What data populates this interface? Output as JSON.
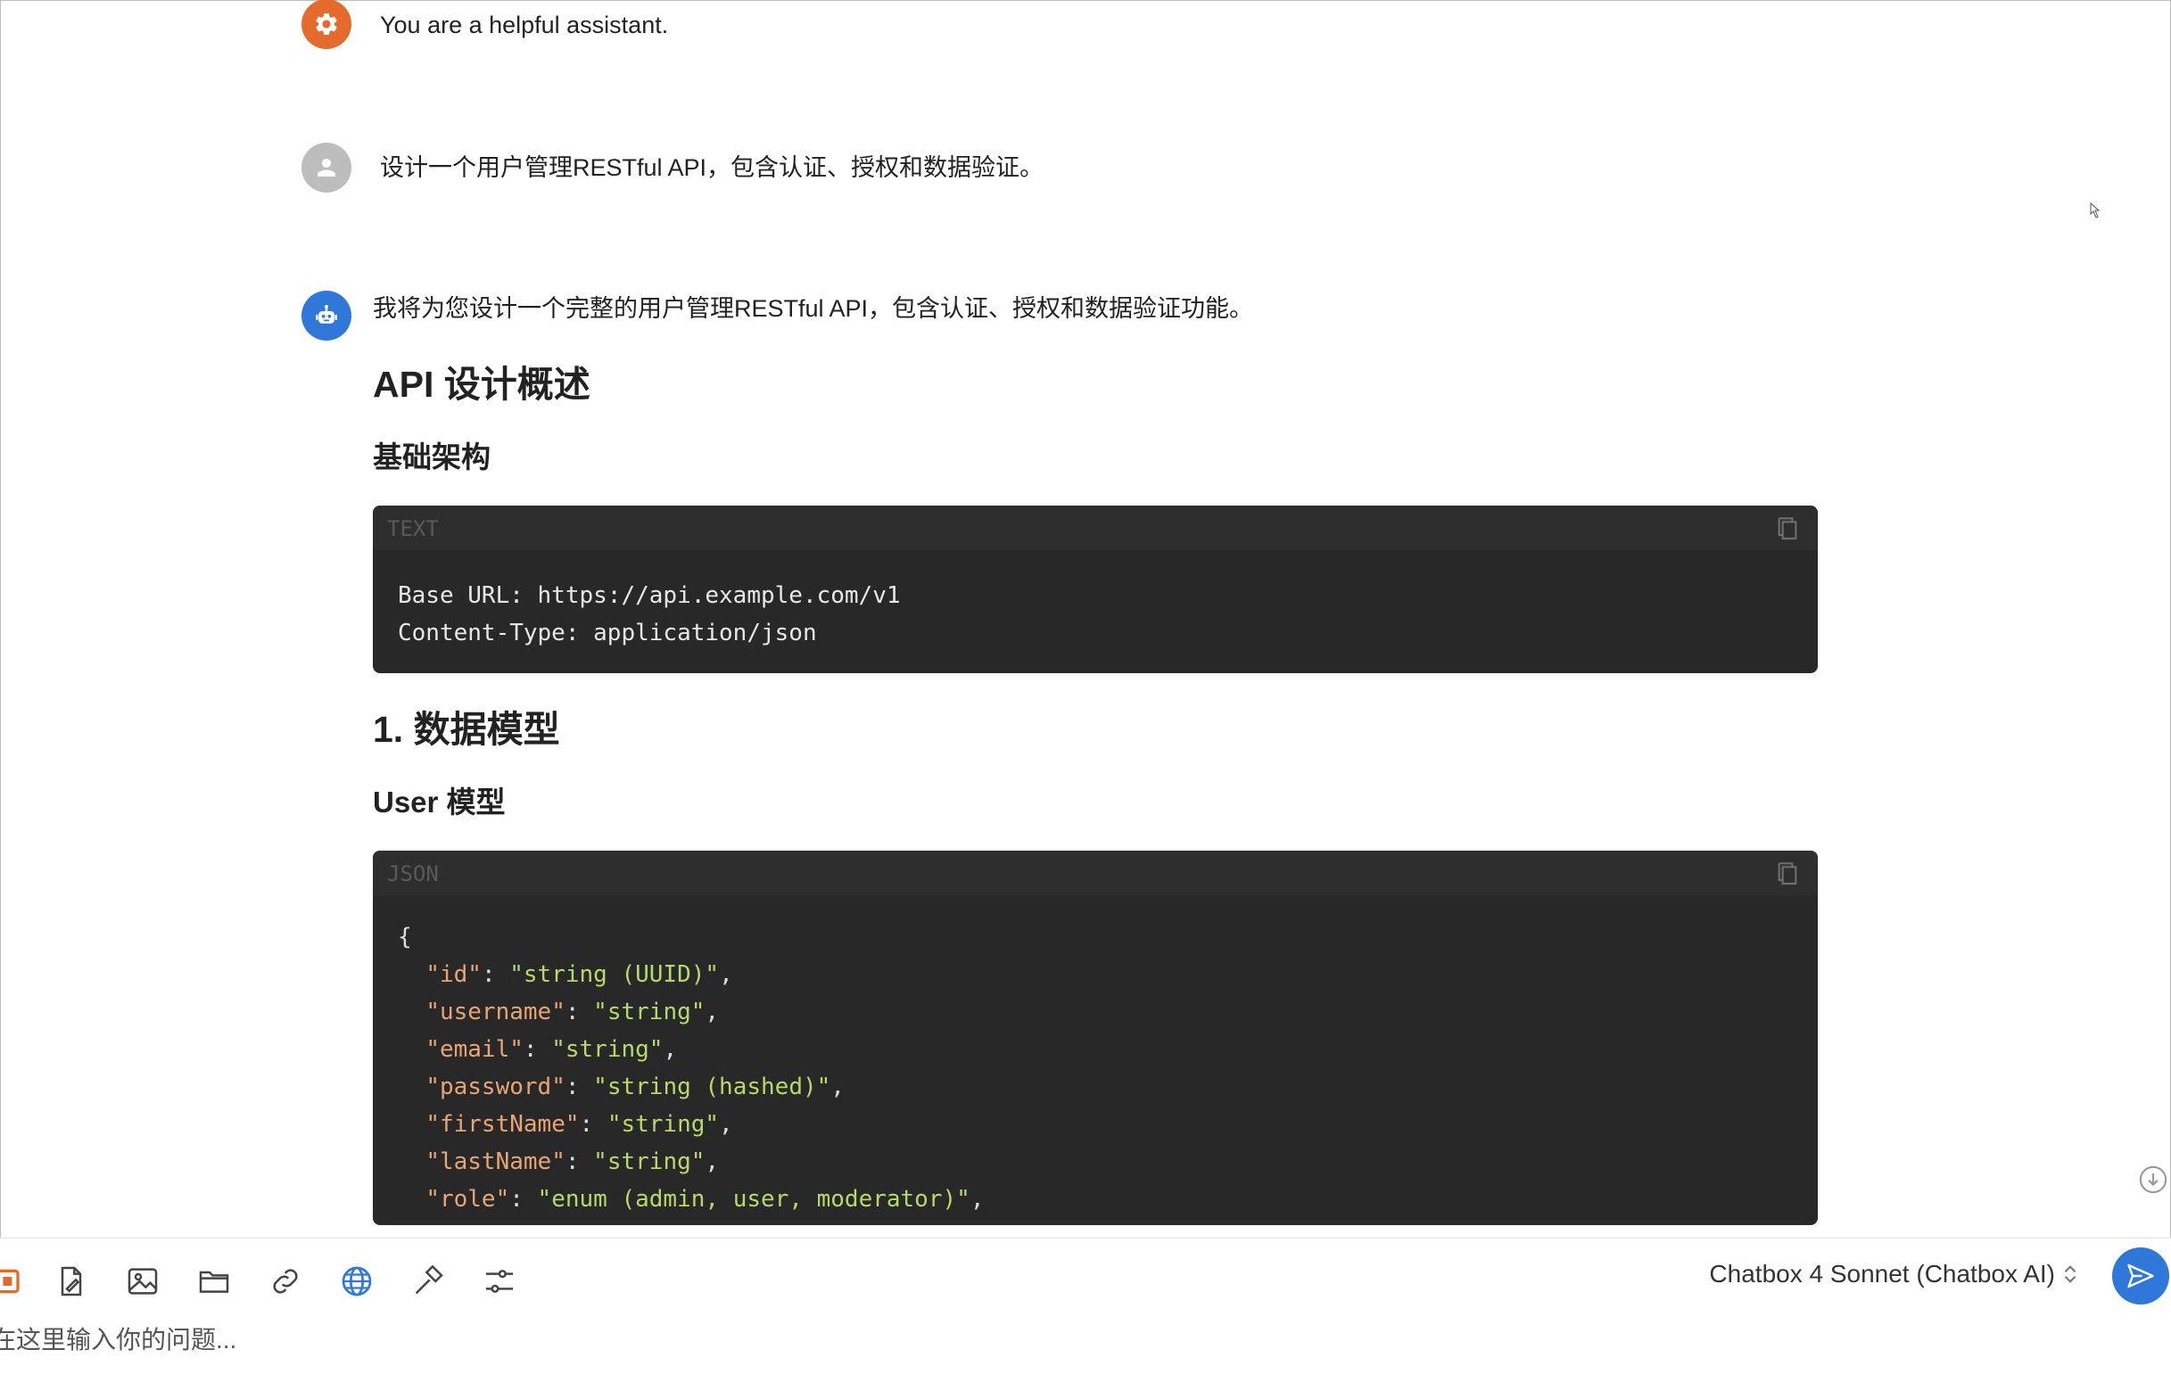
{
  "messages": {
    "system": {
      "text": "You are a helpful assistant."
    },
    "user": {
      "text": "设计一个用户管理RESTful API，包含认证、授权和数据验证。"
    },
    "assistant": {
      "lead": "我将为您设计一个完整的用户管理RESTful API，包含认证、授权和数据验证功能。",
      "heading_1": "API 设计概述",
      "subheading_1": "基础架构",
      "code_1": {
        "lang": "TEXT",
        "lines": [
          "Base URL: https://api.example.com/v1",
          "Content-Type: application/json"
        ]
      },
      "heading_2": "1. 数据模型",
      "subheading_2": "User 模型",
      "code_2": {
        "lang": "JSON",
        "open": "{",
        "fields": [
          {
            "key": "\"id\"",
            "value": "\"string (UUID)\""
          },
          {
            "key": "\"username\"",
            "value": "\"string\""
          },
          {
            "key": "\"email\"",
            "value": "\"string\""
          },
          {
            "key": "\"password\"",
            "value": "\"string (hashed)\""
          },
          {
            "key": "\"firstName\"",
            "value": "\"string\""
          },
          {
            "key": "\"lastName\"",
            "value": "\"string\""
          },
          {
            "key": "\"role\"",
            "value": "\"enum (admin, user, moderator)\""
          }
        ]
      }
    }
  },
  "input": {
    "placeholder": "在这里输入你的问题...",
    "tools": [
      "attachment-icon",
      "file-icon",
      "image-icon",
      "folder-icon",
      "link-icon",
      "globe-icon",
      "hammer-icon",
      "settings-sliders-icon"
    ]
  },
  "model_selector": {
    "label": "Chatbox 4 Sonnet (Chatbox AI)"
  },
  "colors": {
    "system_avatar": "#e46b2c",
    "user_avatar": "#bdbdbd",
    "assistant_avatar": "#2f77d8",
    "code_bg": "#282828",
    "json_key": "#e8a573",
    "json_string": "#b7d96a",
    "send_button": "#2f77d8"
  }
}
